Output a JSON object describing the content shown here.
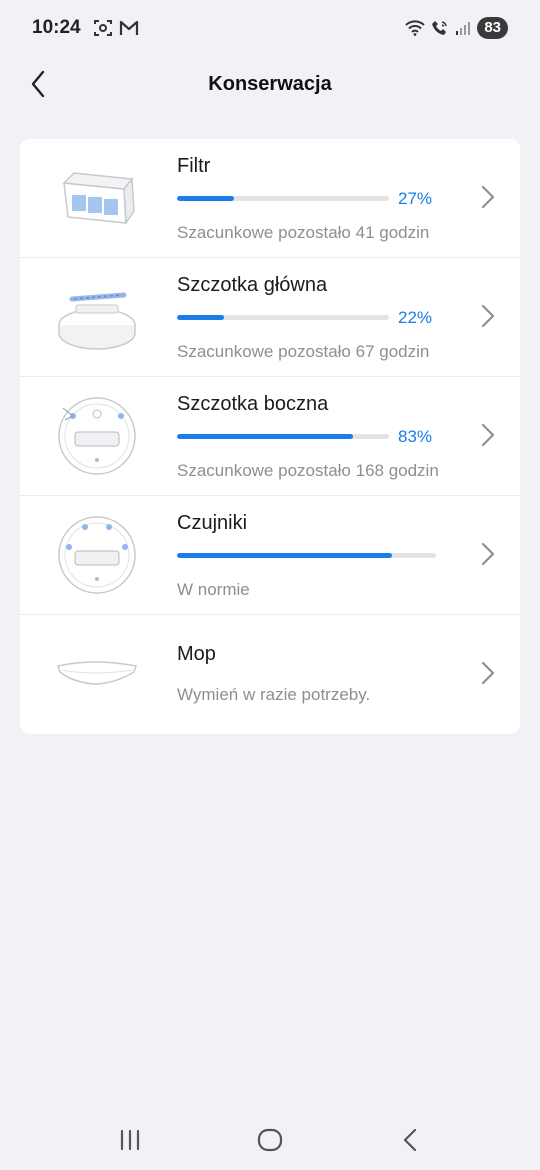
{
  "status": {
    "time": "10:24",
    "battery": "83",
    "icons": [
      "screenshot-icon",
      "gmail-icon",
      "wifi-icon",
      "wifi-call-icon",
      "signal-icon"
    ]
  },
  "header": {
    "title": "Konserwacja",
    "back_icon": "chevron-left-icon"
  },
  "colors": {
    "accent": "#1a7ee8",
    "background": "#f2f2f6"
  },
  "items": [
    {
      "name": "Filtr",
      "level": 0.27,
      "percent": "27%",
      "subtitle": "Szacunkowe pozostało 41 godzin",
      "image": "filter-icon"
    },
    {
      "name": "Szczotka główna",
      "level": 0.22,
      "percent": "22%",
      "subtitle": "Szacunkowe pozostało 67 godzin",
      "image": "main-brush-icon"
    },
    {
      "name": "Szczotka boczna",
      "level": 0.83,
      "percent": "83%",
      "subtitle": "Szacunkowe pozostało 168 godzin",
      "image": "side-brush-icon"
    },
    {
      "name": "Czujniki",
      "level": 0.83,
      "percent": "",
      "subtitle": "W normie",
      "image": "sensors-icon"
    },
    {
      "name": "Mop",
      "subtitle": "Wymień w razie potrzeby.",
      "image": "mop-icon"
    }
  ],
  "navbar": {
    "icons": [
      "recent-apps-icon",
      "home-icon",
      "back-icon"
    ]
  }
}
